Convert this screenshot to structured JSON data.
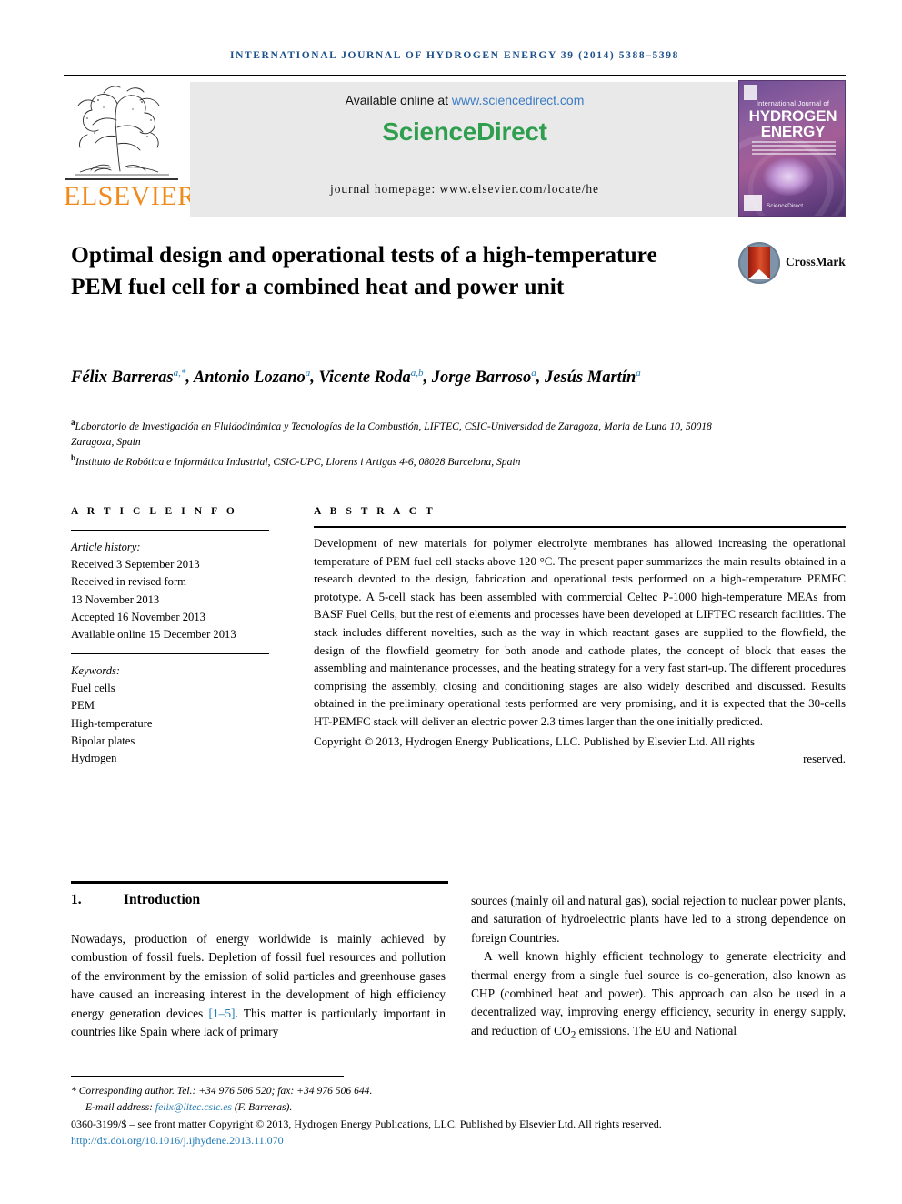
{
  "running_head": "INTERNATIONAL JOURNAL OF HYDROGEN ENERGY 39 (2014) 5388–5398",
  "masthead": {
    "publisher": "ELSEVIER",
    "available_prefix": "Available online at ",
    "available_url": "www.sciencedirect.com",
    "sciencedirect_logo": "ScienceDirect",
    "journal_homepage": "journal homepage: www.elsevier.com/locate/he",
    "cover": {
      "supertitle": "International Journal of",
      "title_line1": "HYDROGEN",
      "title_line2": "ENERGY",
      "footer_brand": "ScienceDirect"
    },
    "colors": {
      "elsevier_orange": "#f08a1c",
      "sciencedirect_green": "#2f9e4f",
      "link_blue": "#3b7cc4",
      "band_grey": "#e9e9e9"
    }
  },
  "article": {
    "title": "Optimal design and operational tests of a high-temperature PEM fuel cell for a combined heat and power unit",
    "crossmark_label": "CrossMark",
    "authors_line1": "Félix Barreras",
    "authors_html": [
      {
        "name": "Félix Barreras",
        "sup": "a,*"
      },
      {
        "name": "Antonio Lozano",
        "sup": "a"
      },
      {
        "name": "Vicente Roda",
        "sup": "a,b"
      },
      {
        "name": "Jorge Barroso",
        "sup": "a"
      },
      {
        "name": "Jesús Martín",
        "sup": "a"
      }
    ],
    "affiliations": [
      {
        "sup": "a",
        "text": "Laboratorio de Investigación en Fluidodinámica y Tecnologías de la Combustión, LIFTEC, CSIC-Universidad de Zaragoza, Maria de Luna 10, 50018 Zaragoza, Spain"
      },
      {
        "sup": "b",
        "text": "Instituto de Robótica e Informática Industrial, CSIC-UPC, Llorens i Artigas 4-6, 08028 Barcelona, Spain"
      }
    ]
  },
  "article_info": {
    "heading": "A R T I C L E   I N F O",
    "history_label": "Article history:",
    "history": [
      "Received 3 September 2013",
      "Received in revised form",
      "13 November 2013",
      "Accepted 16 November 2013",
      "Available online 15 December 2013"
    ],
    "keywords_label": "Keywords:",
    "keywords": [
      "Fuel cells",
      "PEM",
      "High-temperature",
      "Bipolar plates",
      "Hydrogen"
    ]
  },
  "abstract": {
    "heading": "A B S T R A C T",
    "text": "Development of new materials for polymer electrolyte membranes has allowed increasing the operational temperature of PEM fuel cell stacks above 120 °C. The present paper summarizes the main results obtained in a research devoted to the design, fabrication and operational tests performed on a high-temperature PEMFC prototype. A 5-cell stack has been assembled with commercial Celtec P-1000 high-temperature MEAs from BASF Fuel Cells, but the rest of elements and processes have been developed at LIFTEC research facilities. The stack includes different novelties, such as the way in which reactant gases are supplied to the flowfield, the design of the flowfield geometry for both anode and cathode plates, the concept of block that eases the assembling and maintenance processes, and the heating strategy for a very fast start-up. The different procedures comprising the assembly, closing and conditioning stages are also widely described and discussed. Results obtained in the preliminary operational tests performed are very promising, and it is expected that the 30-cells HT-PEMFC stack will deliver an electric power 2.3 times larger than the one initially predicted.",
    "copyright": "Copyright © 2013, Hydrogen Energy Publications, LLC. Published by Elsevier Ltd. All rights",
    "copyright_last": "reserved."
  },
  "body": {
    "section_number": "1.",
    "section_title": "Introduction",
    "left_column_pre": "Nowadays, production of energy worldwide is mainly achieved by combustion of fossil fuels. Depletion of fossil fuel resources and pollution of the environment by the emission of solid particles and greenhouse gases have caused an increasing interest in the development of high efficiency energy generation devices ",
    "left_column_ref": "[1–5]",
    "left_column_post": ". This matter is particularly important in countries like Spain where lack of primary",
    "right_paragraph_1": "sources (mainly oil and natural gas), social rejection to nuclear power plants, and saturation of hydroelectric plants have led to a strong dependence on foreign Countries.",
    "right_paragraph_2_pre": "A well known highly efficient technology to generate electricity and thermal energy from a single fuel source is co-generation, also known as CHP (combined heat and power). This approach can also be used in a decentralized way, improving energy efficiency, security in energy supply, and reduction of CO",
    "right_paragraph_2_sub": "2",
    "right_paragraph_2_post": " emissions. The EU and National"
  },
  "footnotes": {
    "corresponding": "* Corresponding author. Tel.: +34 976 506 520; fax: +34 976 506 644.",
    "email_label": "E-mail address: ",
    "email": "felix@litec.csic.es",
    "email_suffix": " (F. Barreras).",
    "front_matter": "0360-3199/$ – see front matter Copyright © 2013, Hydrogen Energy Publications, LLC. Published by Elsevier Ltd. All rights reserved.",
    "doi": "http://dx.doi.org/10.1016/j.ijhydene.2013.11.070"
  }
}
